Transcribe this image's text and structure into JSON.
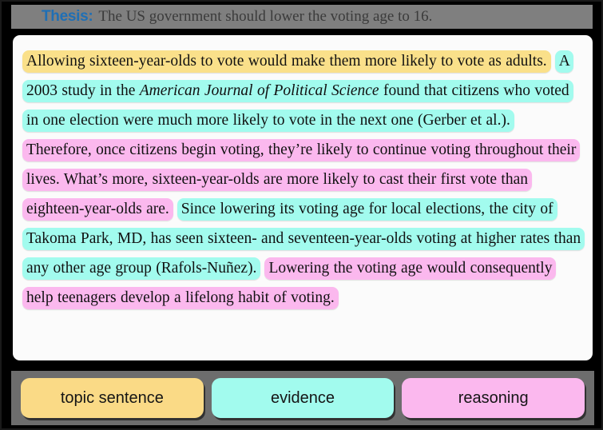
{
  "header": {
    "label": "Thesis:",
    "label_color": "#1f6fb5",
    "text": "The US government should lower the voting age to 16.",
    "strip_color": "#7f7f7f"
  },
  "colors": {
    "topic_sentence": "#fae08a",
    "evidence": "#a2fbee",
    "reasoning": "#fbb8ee",
    "card_background": "#fbfbfb",
    "page_background": "#000000"
  },
  "paragraph": {
    "segments": [
      {
        "category": "topic sentence",
        "color": "#fae08a",
        "text": "Allowing sixteen-year-olds to vote would make them more likely to vote as adults."
      },
      {
        "category": "evidence",
        "color": "#a2fbee",
        "text_before_italic": "A 2003 study in the ",
        "italic": "American Journal of Political Science",
        "text_after_italic": " found that citizens who voted in one election were much more likely to vote in the next one (Gerber et al.)."
      },
      {
        "category": "reasoning",
        "color": "#fbb8ee",
        "text": "Therefore, once citizens begin voting, they’re likely to continue voting throughout their lives. What’s more, sixteen-year-olds are more likely to cast their first vote than eighteen-year-olds are."
      },
      {
        "category": "evidence",
        "color": "#a2fbee",
        "text": "Since lowering its voting age for local elections, the city of Takoma Park, MD, has seen sixteen- and seventeen-year-olds voting at higher rates than any other age group (Rafols-Nuñez)."
      },
      {
        "category": "reasoning",
        "color": "#fbb8ee",
        "text": "Lowering the voting age would consequently help teenagers develop a lifelong habit of voting."
      }
    ]
  },
  "legend": {
    "items": [
      {
        "label": "topic sentence",
        "color": "#fada86"
      },
      {
        "label": "evidence",
        "color": "#a2fbee"
      },
      {
        "label": "reasoning",
        "color": "#fbb8ee"
      }
    ]
  }
}
